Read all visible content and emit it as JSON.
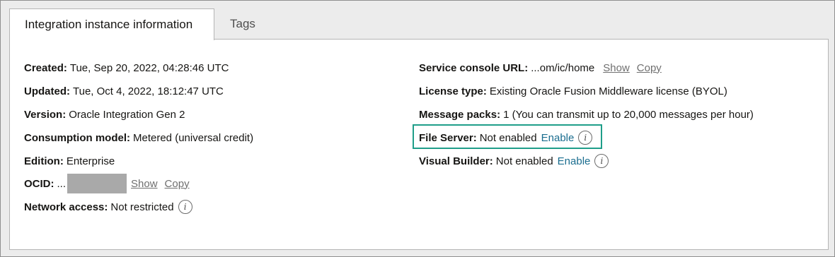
{
  "tabs": [
    {
      "label": "Integration instance information",
      "active": true
    },
    {
      "label": "Tags",
      "active": false
    }
  ],
  "left": {
    "created": {
      "label": "Created:",
      "value": "Tue, Sep 20, 2022, 04:28:46 UTC"
    },
    "updated": {
      "label": "Updated:",
      "value": "Tue, Oct 4, 2022, 18:12:47 UTC"
    },
    "version": {
      "label": "Version:",
      "value": "Oracle Integration Gen 2"
    },
    "consumption": {
      "label": "Consumption model:",
      "value": "Metered (universal credit)"
    },
    "edition": {
      "label": "Edition:",
      "value": "Enterprise"
    },
    "ocid": {
      "label": "OCID:",
      "value": "...",
      "show": "Show",
      "copy": "Copy"
    },
    "network": {
      "label": "Network access:",
      "value": "Not restricted"
    }
  },
  "right": {
    "console": {
      "label": "Service console URL:",
      "value": "...om/ic/home",
      "show": "Show",
      "copy": "Copy"
    },
    "license": {
      "label": "License type:",
      "value": "Existing Oracle Fusion Middleware license (BYOL)"
    },
    "packs": {
      "label": "Message packs:",
      "value": "1 (You can transmit up to 20,000 messages per hour)"
    },
    "file_server": {
      "label": "File Server:",
      "value": "Not enabled",
      "action": "Enable"
    },
    "visual_builder": {
      "label": "Visual Builder:",
      "value": "Not enabled",
      "action": "Enable"
    }
  },
  "info_glyph": "i",
  "colors": {
    "link": "#1a6d8f",
    "highlight": "#1f9e89",
    "redaction": "#a9a9a9"
  }
}
